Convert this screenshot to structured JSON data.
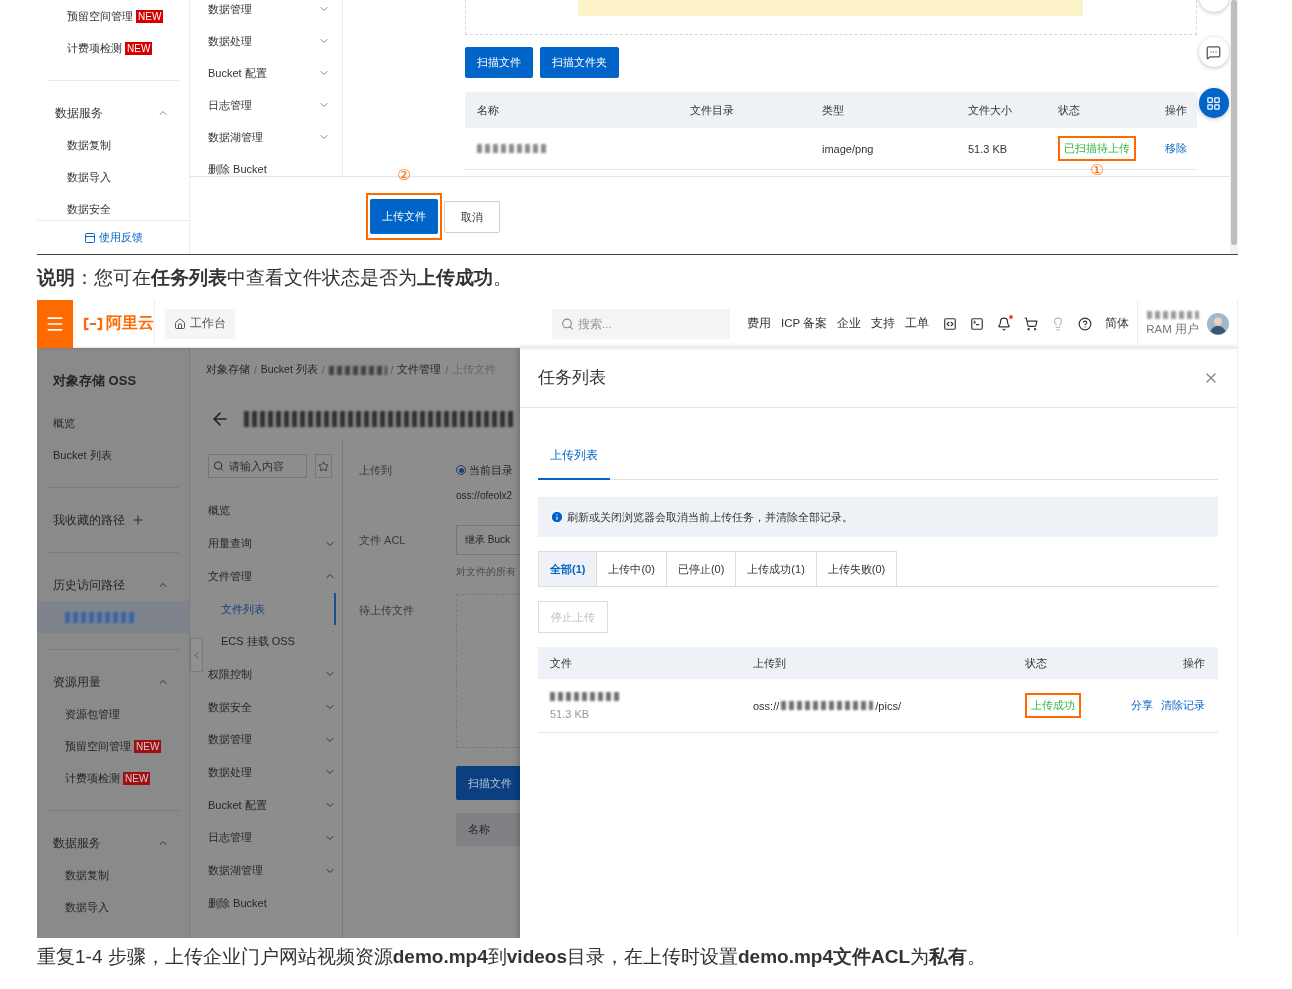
{
  "top_screenshot": {
    "sidebar": {
      "groups": [
        {
          "kind": "plain",
          "items": [
            {
              "label": "预留空间管理",
              "badge": "NEW",
              "selected": false
            },
            {
              "label": "计费项检测",
              "badge": "NEW",
              "selected": false
            }
          ]
        },
        {
          "kind": "section",
          "title": "数据服务",
          "expanded": true,
          "items": [
            {
              "label": "数据复制",
              "selected": false
            },
            {
              "label": "数据导入",
              "selected": false
            },
            {
              "label": "数据安全",
              "selected": false
            }
          ]
        }
      ],
      "feedback": "使用反馈"
    },
    "subnav": [
      {
        "label": "数据管理",
        "expanded": false,
        "selected": false
      },
      {
        "label": "数据处理",
        "expanded": false,
        "selected": false
      },
      {
        "label": "Bucket 配置",
        "expanded": false,
        "selected": false
      },
      {
        "label": "日志管理",
        "expanded": false,
        "selected": false
      },
      {
        "label": "数据湖管理",
        "expanded": false,
        "selected": false
      },
      {
        "label": "删除 Bucket",
        "selected": false
      }
    ],
    "scan_buttons": [
      "扫描文件",
      "扫描文件夹"
    ],
    "table": {
      "columns": [
        "名称",
        "文件目录",
        "类型",
        "文件大小",
        "状态",
        "操作"
      ],
      "rows": [
        {
          "type": "image/png",
          "size": "51.3 KB",
          "status": "已扫描待上传",
          "highlighted": true,
          "annotation": "①",
          "action": "移除"
        }
      ]
    },
    "footer_buttons": [
      {
        "label": "上传文件",
        "kind": "primary",
        "highlighted": true,
        "annotation": "②"
      },
      {
        "label": "取消",
        "kind": "default",
        "highlighted": false
      }
    ]
  },
  "note": "**说明**：您可在**任务列表**中查看文件状态是否为**上传成功**。",
  "console_screenshot": {
    "header": {
      "logo": "阿里云",
      "workbench": "工作台",
      "search_placeholder": "搜索...",
      "links": [
        "费用",
        "ICP 备案",
        "企业",
        "支持",
        "工单"
      ],
      "language": "简体",
      "user_role": "RAM 用户"
    },
    "sidebar": {
      "groups": [
        {
          "kind": "product",
          "title": "对象存储 OSS",
          "items": [
            {
              "label": "概览",
              "selected": false
            },
            {
              "label": "Bucket 列表",
              "selected": false
            }
          ]
        },
        {
          "kind": "favorites",
          "title": "我收藏的路径"
        },
        {
          "kind": "section",
          "title": "历史访问路径",
          "expanded": true,
          "items": [
            {
              "kind": "redacted",
              "selected": true
            }
          ]
        },
        {
          "kind": "section",
          "title": "资源用量",
          "expanded": true,
          "items": [
            {
              "label": "资源包管理",
              "selected": false
            },
            {
              "label": "预留空间管理",
              "badge": "NEW",
              "selected": false
            },
            {
              "label": "计费项检测",
              "badge": "NEW",
              "selected": false
            }
          ]
        },
        {
          "kind": "section",
          "title": "数据服务",
          "expanded": true,
          "items": [
            {
              "label": "数据复制",
              "selected": false
            },
            {
              "label": "数据导入",
              "selected": false
            }
          ]
        }
      ]
    },
    "breadcrumb": [
      {
        "kind": "text",
        "label": "对象存储"
      },
      {
        "kind": "separator",
        "label": "/"
      },
      {
        "kind": "text",
        "label": "Bucket 列表"
      },
      {
        "kind": "separator",
        "label": "/"
      },
      {
        "kind": "redacted"
      },
      {
        "kind": "separator",
        "label": "/"
      },
      {
        "kind": "text",
        "label": "文件管理"
      },
      {
        "kind": "separator",
        "label": "/"
      },
      {
        "kind": "text",
        "label": "上传文件"
      }
    ],
    "subnav_search_placeholder": "请输入内容",
    "subnav": [
      {
        "label": "概览",
        "selected": false
      },
      {
        "label": "用量查询",
        "expanded": false,
        "selected": false
      },
      {
        "label": "文件管理",
        "expanded": true,
        "selected": false,
        "children": [
          {
            "label": "文件列表",
            "selected": true
          },
          {
            "label": "ECS 挂载 OSS",
            "selected": false
          }
        ]
      },
      {
        "label": "权限控制",
        "expanded": false,
        "selected": false
      },
      {
        "label": "数据安全",
        "expanded": false,
        "selected": false
      },
      {
        "label": "数据管理",
        "expanded": false,
        "selected": false
      },
      {
        "label": "数据处理",
        "expanded": false,
        "selected": false
      },
      {
        "label": "Bucket 配置",
        "expanded": false,
        "selected": false
      },
      {
        "label": "日志管理",
        "expanded": false,
        "selected": false
      },
      {
        "label": "数据湖管理",
        "expanded": false,
        "selected": false
      },
      {
        "label": "删除 Bucket",
        "selected": false
      }
    ],
    "upload_form": {
      "upload_to": {
        "label": "上传到",
        "option": "当前目录",
        "selected": true
      },
      "path": "oss://ofeolx2",
      "acl": {
        "label": "文件 ACL",
        "value": "继承 Buck",
        "help": "对文件的所有"
      },
      "pending_label": "待上传文件",
      "scan_button": "扫描文件",
      "table_columns": [
        "名称"
      ]
    },
    "task_drawer": {
      "title": "任务列表",
      "tabs": [
        {
          "label": "上传列表",
          "selected": true
        }
      ],
      "notice": "刷新或关闭浏览器会取消当前上传任务，并清除全部记录。",
      "filters": [
        {
          "label": "全部(1)",
          "selected": true
        },
        {
          "label": "上传中(0)",
          "selected": false
        },
        {
          "label": "已停止(0)",
          "selected": false
        },
        {
          "label": "上传成功(1)",
          "selected": false
        },
        {
          "label": "上传失败(0)",
          "selected": false
        }
      ],
      "stop_button": {
        "label": "停止上传",
        "disabled": true
      },
      "table": {
        "columns": [
          "文件",
          "上传到",
          "状态",
          "操作"
        ],
        "rows": [
          {
            "size": "51.3 KB",
            "path_prefix": "oss://",
            "path_suffix": "/pics/",
            "status": "上传成功",
            "highlighted": true,
            "actions": [
              "分享",
              "清除记录"
            ]
          }
        ]
      }
    }
  },
  "instruction": "重复1-4 步骤，上传企业门户网站视频资源**demo.mp4**到**videos**目录，在上传时设置**demo.mp4文件ACL**为**私有**。"
}
